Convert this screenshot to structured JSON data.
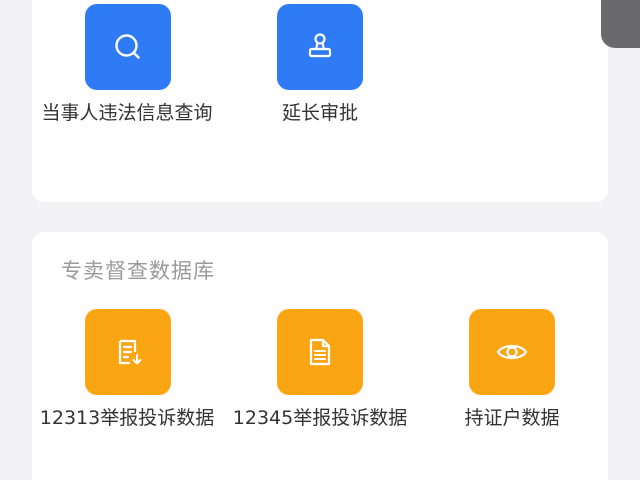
{
  "top_section": {
    "items": [
      {
        "label": "当事人违法信息查询",
        "icon": "search-icon",
        "color": "#2f7bf5"
      },
      {
        "label": "延长审批",
        "icon": "stamp-icon",
        "color": "#2f7bf5"
      }
    ]
  },
  "database_section": {
    "title": "专卖督查数据库",
    "items": [
      {
        "label": "12313举报投诉数据",
        "icon": "form-edit-icon",
        "color": "#fba512"
      },
      {
        "label": "12345举报投诉数据",
        "icon": "document-icon",
        "color": "#fba512"
      },
      {
        "label": "持证户数据",
        "icon": "eye-icon",
        "color": "#fba512"
      }
    ]
  }
}
